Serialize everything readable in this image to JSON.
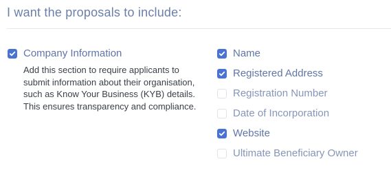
{
  "section": {
    "title": "I want the proposals to include:"
  },
  "company_info": {
    "label": "Company Information",
    "checked": true,
    "description": "Add this section to require applicants to submit information about their organisation, such as Know Your Business (KYB) details. This ensures transparency and compliance."
  },
  "fields": [
    {
      "label": "Name",
      "checked": true
    },
    {
      "label": "Registered Address",
      "checked": true
    },
    {
      "label": "Registration Number",
      "checked": false
    },
    {
      "label": "Date of Incorporation",
      "checked": false
    },
    {
      "label": "Website",
      "checked": true
    },
    {
      "label": "Ultimate Beneficiary Owner",
      "checked": false
    }
  ],
  "colors": {
    "accent": "#4a72d3",
    "title": "#6b7fa8",
    "description_text": "#3a3f47"
  }
}
